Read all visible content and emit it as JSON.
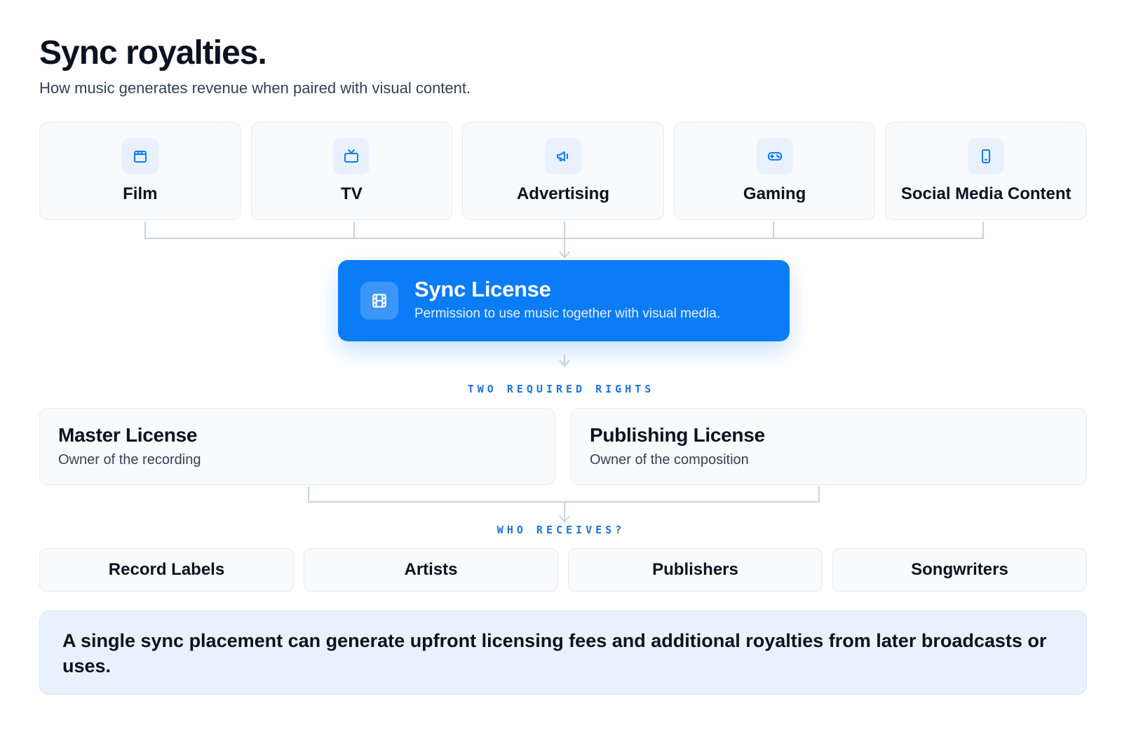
{
  "header": {
    "title": "Sync royalties.",
    "subtitle": "How music generates revenue when paired with visual content."
  },
  "media": [
    {
      "label": "Film",
      "icon": "clapperboard-icon"
    },
    {
      "label": "TV",
      "icon": "tv-icon"
    },
    {
      "label": "Advertising",
      "icon": "megaphone-icon"
    },
    {
      "label": "Gaming",
      "icon": "gamepad-icon"
    },
    {
      "label": "Social Media Content",
      "icon": "smartphone-icon"
    }
  ],
  "sync_license": {
    "title": "Sync License",
    "description": "Permission to use music together with visual media.",
    "icon": "film-strip-icon"
  },
  "rights_label": "TWO REQUIRED RIGHTS",
  "rights": [
    {
      "title": "Master License",
      "description": "Owner of the recording"
    },
    {
      "title": "Publishing License",
      "description": "Owner of the composition"
    }
  ],
  "recipients_label": "WHO RECEIVES?",
  "recipients": [
    "Record Labels",
    "Artists",
    "Publishers",
    "Songwriters"
  ],
  "note": "A single sync placement can generate upfront licensing fees and additional royalties from later broadcasts or uses.",
  "colors": {
    "accent": "#0a7cf5",
    "label": "#1d72d8",
    "connector": "#c7d3e0",
    "note_bg": "#e8f2fe"
  }
}
